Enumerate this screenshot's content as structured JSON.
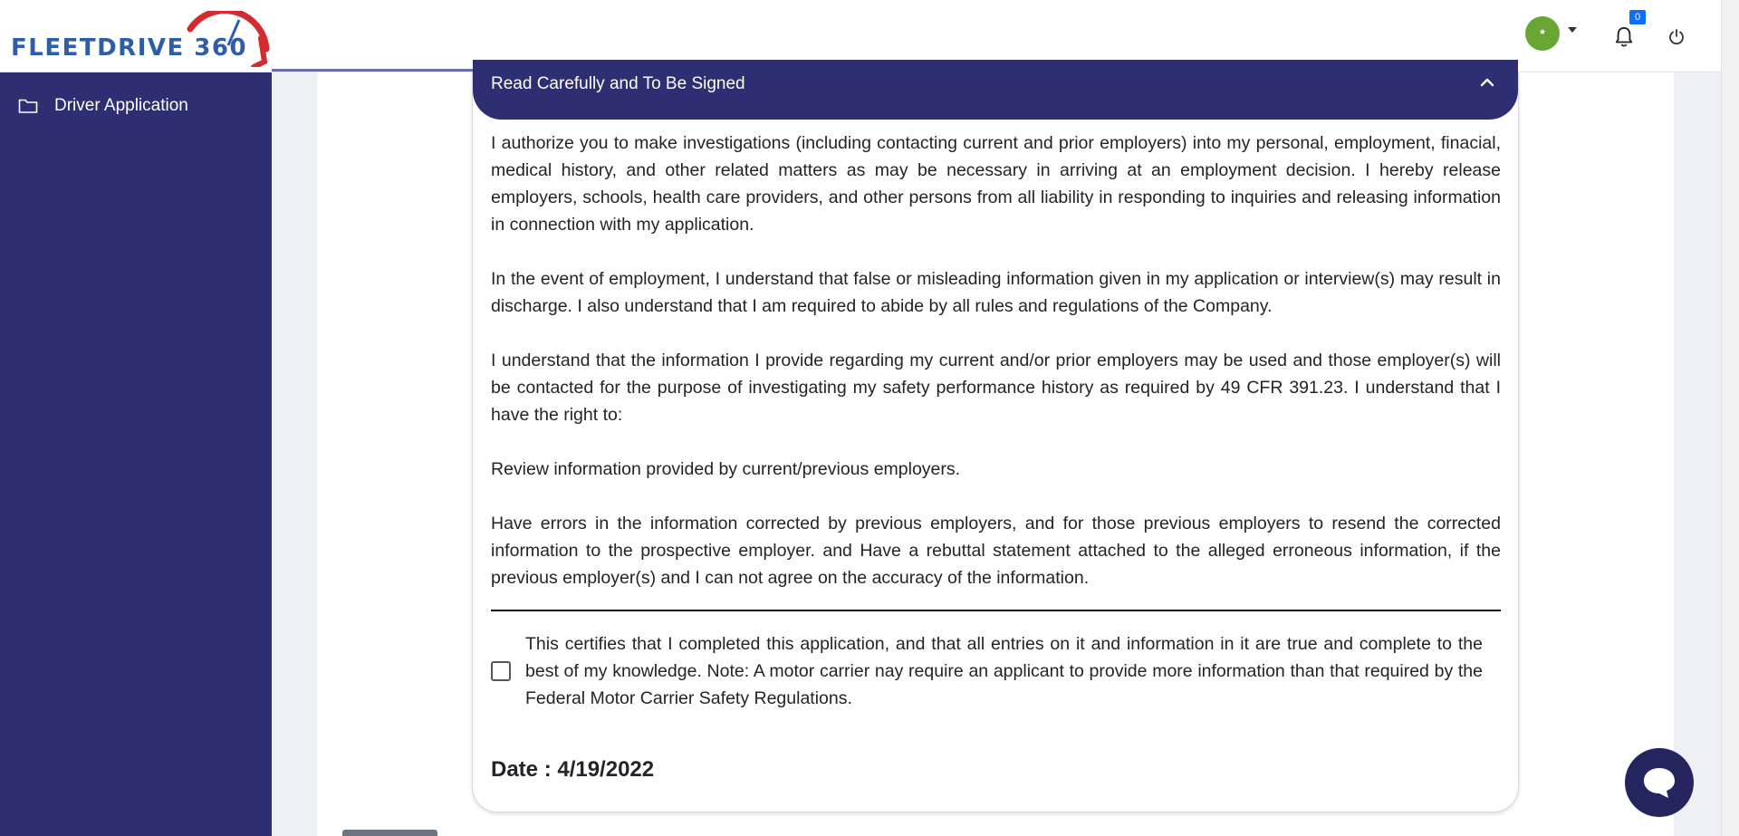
{
  "brand": {
    "logo_text": "FLEETDRIVE 360"
  },
  "header": {
    "avatar_initial": "*",
    "notification_count": "0"
  },
  "sidebar": {
    "items": [
      {
        "label": "Driver Application",
        "icon": "folder-icon"
      }
    ]
  },
  "section": {
    "title": "Read Carefully and To Be Signed",
    "paragraphs": [
      "I authorize you to make investigations (including contacting current and prior employers) into my personal, employment, finacial, medical history, and other related matters as may be necessary in arriving at an employment decision. I hereby release employers, schools, health care providers, and other persons from all liability in responding to inquiries and releasing information in connection with my application.",
      "In the event of employment, I understand that false or misleading information given in my application or interview(s) may result in discharge. I also understand that I am required to abide by all rules and regulations of the Company.",
      "I understand that the information I provide regarding my current and/or prior employers may be used and those employer(s) will be contacted for the purpose of investigating my safety performance history as required by 49 CFR 391.23. I understand that I have the right to:",
      "Review information provided by current/previous employers.",
      "Have errors in the information corrected by previous employers, and for those previous employers to resend the corrected information to the prospective employer. and Have a rebuttal statement attached to the alleged erroneous information, if the previous employer(s) and I can not agree on the accuracy of the information."
    ],
    "certification": "This certifies that I completed this application, and that all entries on it and information in it are true and complete to the best of my knowledge. Note: A motor carrier nay require an applicant to provide more information than that required by the Federal Motor Carrier Safety Regulations.",
    "certification_checked": false,
    "date_label": "Date : 4/19/2022"
  },
  "colors": {
    "sidebar": "#2e2e73",
    "header_band": "#2e2e73",
    "avatar": "#6aa534",
    "badge": "#0d6efd",
    "logo_text": "#2f5ea8",
    "logo_arc": "#d42a30"
  }
}
